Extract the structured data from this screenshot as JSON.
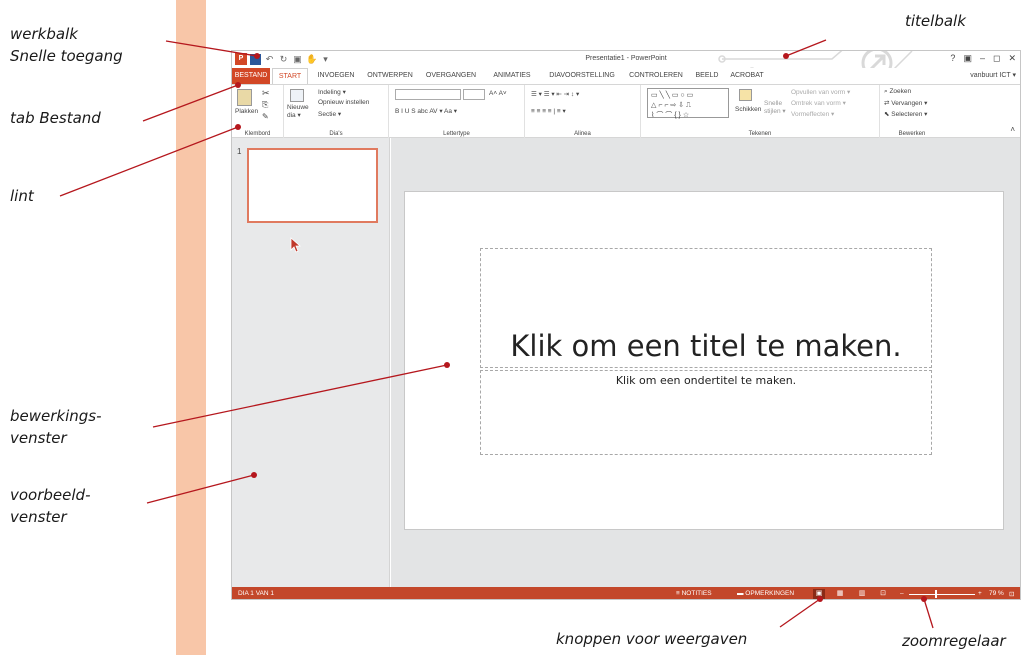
{
  "annotations": {
    "werkbalk": "werkbalk\nSnelle toegang",
    "titelbalk": "titelbalk",
    "tab_bestand": "tab Bestand",
    "lint": "lint",
    "bewerkingsvenster": "bewerkings-\nvenster",
    "voorbeeldvenster": "voorbeeld-\nvenster",
    "knoppen": "knoppen voor weergaven",
    "zoomregelaar": "zoomregelaar"
  },
  "window": {
    "title": "Presentatie1 - PowerPoint",
    "controls": [
      "?",
      "▣",
      "–",
      "◻",
      "✕"
    ],
    "account": "vanbuurt ICT ▾",
    "qat_icons": [
      "powerpoint-logo",
      "save-icon",
      "undo-icon",
      "redo-icon",
      "start-from-beginning-icon",
      "touch-mode-icon",
      "customize-icon"
    ]
  },
  "tabs": [
    "BESTAND",
    "START",
    "INVOEGEN",
    "ONTWERPEN",
    "OVERGANGEN",
    "ANIMATIES",
    "DIAVOORSTELLING",
    "CONTROLEREN",
    "BEELD",
    "ACROBAT"
  ],
  "ribbon": {
    "groups": [
      "Klembord",
      "Dia's",
      "Lettertype",
      "Alinea",
      "Tekenen",
      "Bewerken"
    ],
    "plakken": "Plakken",
    "nieuwe_dia": "Nieuwe\ndia ▾",
    "indeling": "Indeling ▾",
    "opnieuw": "Opnieuw instellen",
    "sectie": "Sectie ▾",
    "font_format": "B  I  U  S  abc  AV ▾  Aa ▾",
    "schikken": "Schikken",
    "snelle_stijlen": "Snelle\nstijlen ▾",
    "opvullen": "Opvullen van vorm ▾",
    "omtrek": "Omtrek van vorm ▾",
    "vormeffecten": "Vormeffecten ▾",
    "zoeken": "Zoeken",
    "vervangen": "Vervangen ▾",
    "selecteren": "Selecteren ▾"
  },
  "thumbnails": {
    "number": "1"
  },
  "slide": {
    "title_placeholder": "Klik om een titel te maken.",
    "subtitle_placeholder": "Klik om een ondertitel te maken."
  },
  "status": {
    "slide_info": "DIA 1 VAN 1",
    "notities": "≡ NOTITIES",
    "opmerkingen": "▬ OPMERKINGEN",
    "zoom": "79 %"
  },
  "colors": {
    "accent": "#d24726",
    "statusbar": "#c3472a",
    "annotation_line": "#b5171d",
    "side_stripe": "#f8c6a8"
  }
}
